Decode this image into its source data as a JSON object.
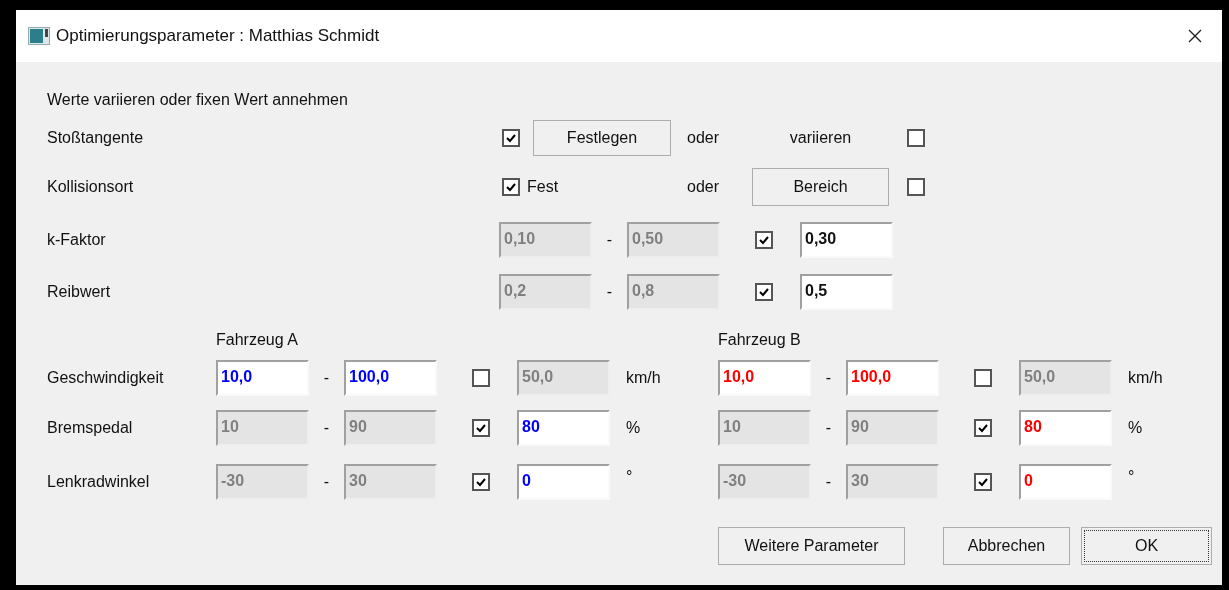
{
  "window": {
    "title": "Optimierungsparameter : Matthias Schmidt"
  },
  "intro": "Werte variieren oder fixen Wert annehmen",
  "fixed_rows": [
    {
      "label": "Stoßtangente",
      "kind": "button",
      "checked": true,
      "fix": "Festlegen",
      "or": "oder",
      "vary": "variieren",
      "vary_checked": false
    },
    {
      "label": "Kollisionsort",
      "kind": "label",
      "checked": true,
      "fix": "Fest",
      "or": "oder",
      "vary": "Bereich",
      "vary_checked": false
    }
  ],
  "range_rows": [
    {
      "label": "k-Faktor",
      "min": "0,10",
      "separator": "-",
      "max": "0,50",
      "fixed": true,
      "value": "0,30"
    },
    {
      "label": "Reibwert",
      "min": "0,2",
      "separator": "-",
      "max": "0,8",
      "fixed": true,
      "value": "0,5"
    }
  ],
  "vehicles": [
    {
      "name": "Fahrzeug A",
      "color": "#0000ff"
    },
    {
      "name": "Fahrzeug B",
      "color": "#ff0000"
    }
  ],
  "vehicle_params": [
    {
      "label": "Geschwindigkeit",
      "values": [
        {
          "min": "10,0",
          "separator": "-",
          "max": "100,0",
          "fixed": false,
          "value": "50,0",
          "unit": "km/h"
        },
        {
          "min": "10,0",
          "separator": "-",
          "max": "100,0",
          "fixed": false,
          "value": "50,0",
          "unit": "km/h"
        }
      ]
    },
    {
      "label": "Bremspedal",
      "values": [
        {
          "min": "10",
          "separator": "-",
          "max": "90",
          "fixed": true,
          "value": "80",
          "unit": "%"
        },
        {
          "min": "10",
          "separator": "-",
          "max": "90",
          "fixed": true,
          "value": "80",
          "unit": "%"
        }
      ]
    },
    {
      "label": "Lenkradwinkel",
      "values": [
        {
          "min": "-30",
          "separator": "-",
          "max": "30",
          "fixed": true,
          "value": "0",
          "unit": "°"
        },
        {
          "min": "-30",
          "separator": "-",
          "max": "30",
          "fixed": true,
          "value": "0",
          "unit": "°"
        }
      ]
    }
  ],
  "buttons": [
    {
      "label": "Weitere Parameter",
      "default": false
    },
    {
      "label": "Abbrechen",
      "default": false
    },
    {
      "label": "OK",
      "default": true
    }
  ]
}
